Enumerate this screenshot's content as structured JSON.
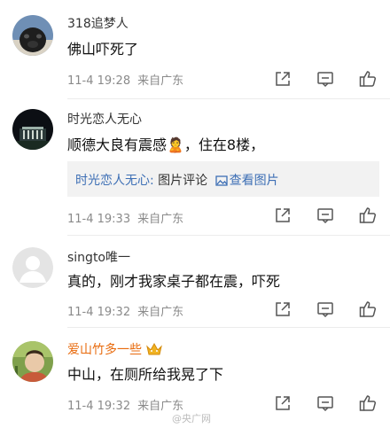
{
  "comments": [
    {
      "username": "318追梦人",
      "text": "佛山吓死了",
      "time": "11-4 19:28",
      "location": "来自广东"
    },
    {
      "username": "时光恋人无心",
      "text": "顺德大良有震感🙎，住在8楼，",
      "time": "11-4 19:33",
      "location": "来自广东",
      "pic_comment": {
        "author": "时光恋人无心:",
        "label": "图片评论",
        "view_link": "查看图片"
      }
    },
    {
      "username": "singto唯一",
      "text": "真的，刚才我家桌子都在震，吓死",
      "time": "11-4 19:32",
      "location": "来自广东"
    },
    {
      "username": "爱山竹多一些",
      "text": "中山，在厕所给我晃了下",
      "time": "11-4 19:32",
      "location": "来自广东"
    }
  ],
  "watermark": "@央广网",
  "icons": {
    "share": "share-icon",
    "comment": "comment-icon",
    "like": "like-icon"
  },
  "colors": {
    "link": "#3d6fb5",
    "vip_name": "#e86a0c",
    "meta": "#8a8a8a"
  }
}
